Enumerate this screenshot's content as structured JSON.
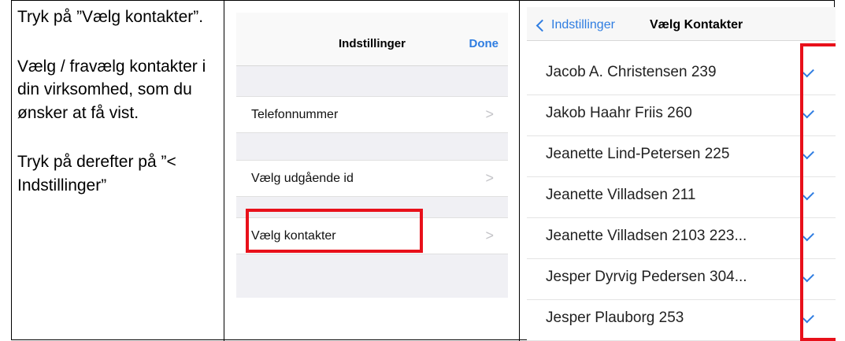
{
  "instructions": {
    "para1": "Tryk på ”Vælg kontakter”.",
    "para2": "Vælg / fravælg kontakter i din virksomhed, som du ønsker at få vist.",
    "para3": "Tryk på derefter på ”< Indstillinger”"
  },
  "settings": {
    "title": "Indstillinger",
    "done_label": "Done",
    "rows": [
      {
        "label": "Telefonnummer"
      },
      {
        "label": "Vælg udgående id"
      },
      {
        "label": "Vælg kontakter"
      }
    ]
  },
  "contacts": {
    "back_label": "Indstillinger",
    "title": "Vælg Kontakter",
    "items": [
      {
        "name": "Jacob A. Christensen 239",
        "checked": true
      },
      {
        "name": "Jakob Haahr Friis 260",
        "checked": true
      },
      {
        "name": "Jeanette Lind-Petersen 225",
        "checked": true
      },
      {
        "name": "Jeanette Villadsen 211",
        "checked": true
      },
      {
        "name": "Jeanette Villadsen 2103 223...",
        "checked": true
      },
      {
        "name": "Jesper Dyrvig Pedersen 304...",
        "checked": true
      },
      {
        "name": "Jesper Plauborg 253",
        "checked": true
      }
    ]
  },
  "colors": {
    "accent": "#2f7de1",
    "highlight": "#e8101a"
  }
}
